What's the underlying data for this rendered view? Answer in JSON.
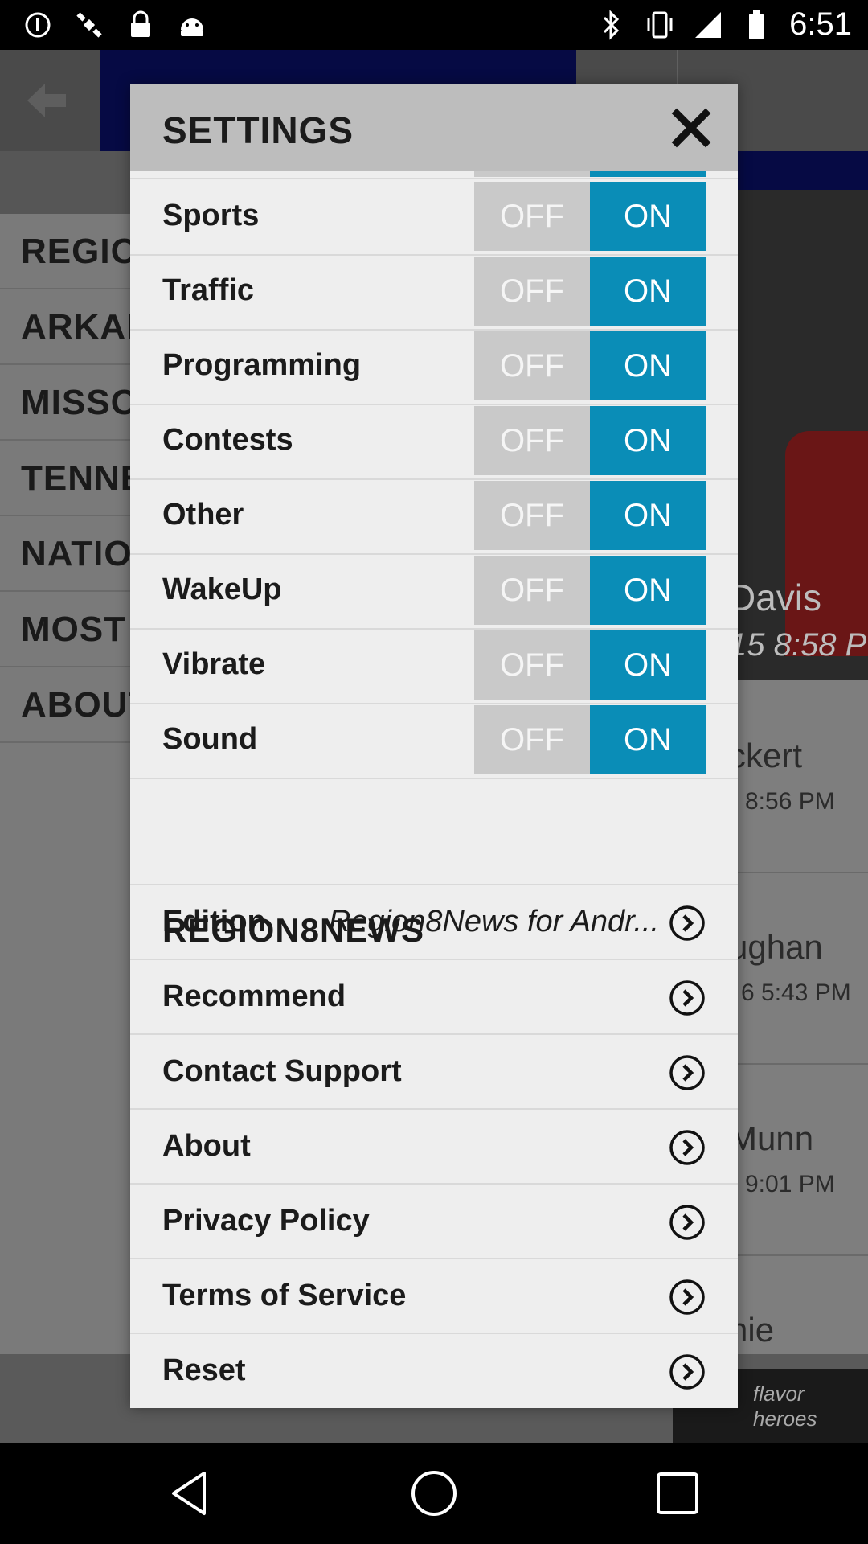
{
  "status_bar": {
    "time": "6:51",
    "left_icons": [
      "circle-alert-icon",
      "satellite-icon",
      "lock-icon",
      "android-icon"
    ],
    "right_icons": [
      "bluetooth-icon",
      "vibrate-icon",
      "signal-icon",
      "battery-icon"
    ]
  },
  "background_app": {
    "menu_items": [
      "REGIO",
      "ARKAN",
      "MISSO",
      "TENNE",
      "NATIO",
      "MOST",
      "ABOUT"
    ],
    "stories": [
      {
        "name": "Davis",
        "time": "15 8:58 P"
      },
      {
        "name": "ckert",
        "time": "8:56 PM"
      },
      {
        "name": "ughan",
        "time": "6 5:43 PM"
      },
      {
        "name": "Munn",
        "time": "9:01 PM"
      },
      {
        "name": "nie Privet",
        "time": ""
      }
    ],
    "ad_text": "flavor heroes"
  },
  "dialog": {
    "title": "SETTINGS",
    "toggles": [
      {
        "label": "Sports",
        "off": "OFF",
        "on": "ON",
        "state": "on"
      },
      {
        "label": "Traffic",
        "off": "OFF",
        "on": "ON",
        "state": "on"
      },
      {
        "label": "Programming",
        "off": "OFF",
        "on": "ON",
        "state": "on"
      },
      {
        "label": "Contests",
        "off": "OFF",
        "on": "ON",
        "state": "on"
      },
      {
        "label": "Other",
        "off": "OFF",
        "on": "ON",
        "state": "on"
      },
      {
        "label": "WakeUp",
        "off": "OFF",
        "on": "ON",
        "state": "on"
      },
      {
        "label": "Vibrate",
        "off": "OFF",
        "on": "ON",
        "state": "on"
      },
      {
        "label": "Sound",
        "off": "OFF",
        "on": "ON",
        "state": "on"
      }
    ],
    "section_title": "REGION8NEWS",
    "links": [
      {
        "label": "Edition",
        "value": "Region8News for Andr..."
      },
      {
        "label": "Recommend",
        "value": ""
      },
      {
        "label": "Contact Support",
        "value": ""
      },
      {
        "label": "About",
        "value": ""
      },
      {
        "label": "Privacy Policy",
        "value": ""
      },
      {
        "label": "Terms of Service",
        "value": ""
      },
      {
        "label": "Reset",
        "value": ""
      }
    ],
    "colors": {
      "on": "#0a8db7",
      "off": "#c9c9c9",
      "header": "#bdbdbd"
    }
  }
}
